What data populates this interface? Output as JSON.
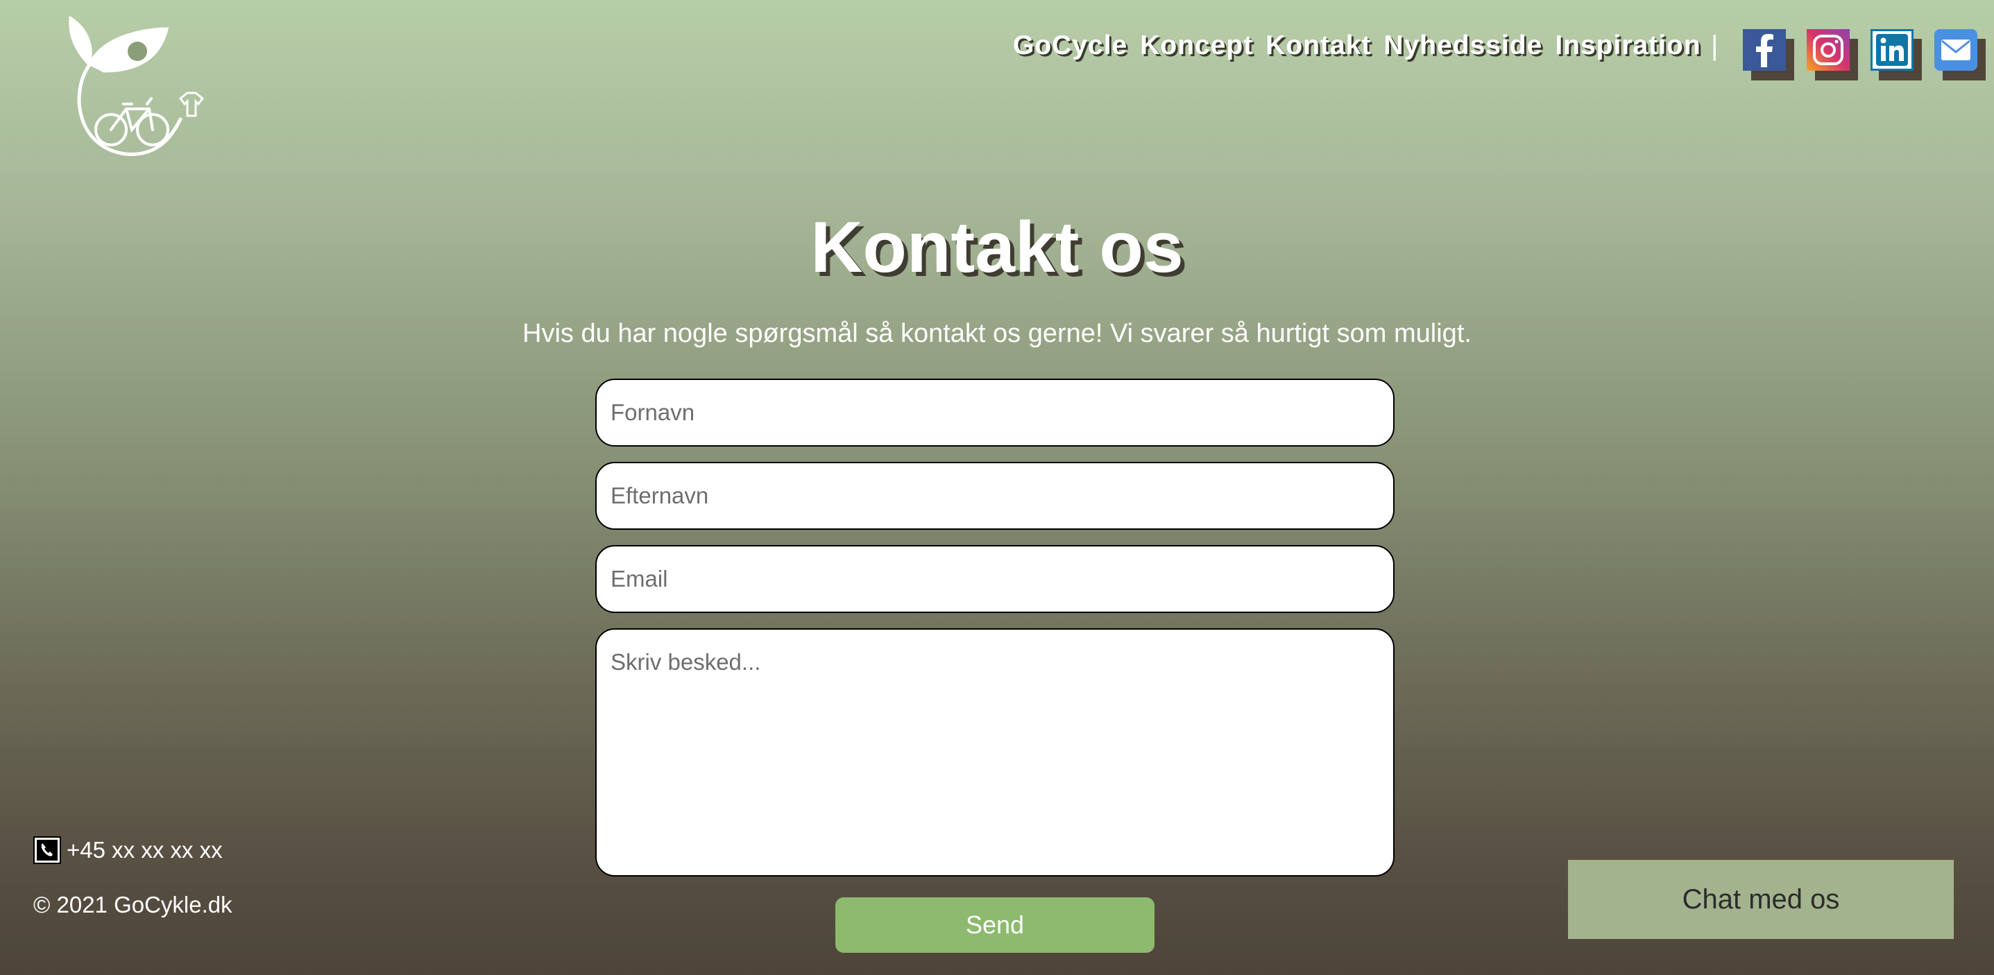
{
  "header": {
    "nav": [
      "GoCycle",
      "Koncept",
      "Kontakt",
      "Nyhedsside",
      "Inspiration"
    ],
    "separator": "|",
    "social": [
      {
        "icon": "facebook-icon",
        "letter": "f",
        "color": "#3b5998"
      },
      {
        "icon": "instagram-icon",
        "color": "#d6336c"
      },
      {
        "icon": "linkedin-icon",
        "letter": "in",
        "color": "#0e76a8"
      },
      {
        "icon": "mail-icon",
        "color": "#4a90e2"
      }
    ]
  },
  "main": {
    "title": "Kontakt os",
    "subtitle": "Hvis du har nogle spørgsmål så kontakt os gerne! Vi svarer så hurtigt som muligt.",
    "form": {
      "firstname_placeholder": "Fornavn",
      "lastname_placeholder": "Efternavn",
      "email_placeholder": "Email",
      "message_placeholder": "Skriv besked...",
      "send_label": "Send"
    }
  },
  "footer": {
    "phone": "+45 xx xx xx xx",
    "copyright": "© 2021 GoCykle.dk",
    "chat_label": "Chat med os"
  }
}
